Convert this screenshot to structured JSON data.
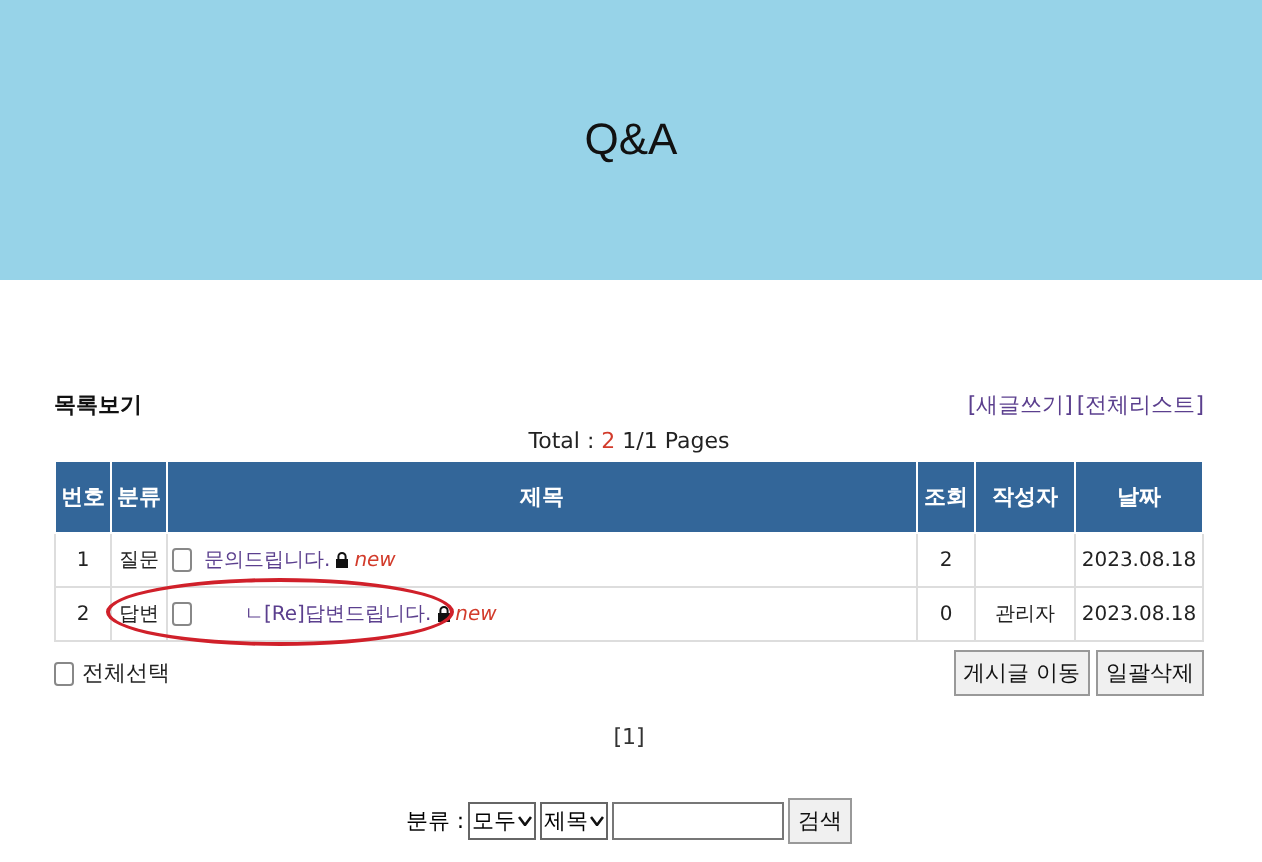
{
  "header": {
    "title": "Q&A"
  },
  "board": {
    "heading": "목록보기",
    "links": [
      "[새글쓰기]",
      "[전체리스트]"
    ],
    "summary": {
      "label": "Total : ",
      "count": "2",
      "pages": " 1/1 Pages"
    },
    "columns": [
      "번호",
      "분류",
      "제목",
      "조회",
      "작성자",
      "날짜"
    ],
    "rows": [
      {
        "number": "1",
        "category": "질문",
        "checked": false,
        "reply": false,
        "title": "문의드립니다.",
        "locked": true,
        "badge": "new",
        "views": "2",
        "author": "",
        "date": "2023.08.18",
        "highlighted": false
      },
      {
        "number": "2",
        "category": "답변",
        "checked": false,
        "reply": true,
        "title": "ㄴ[Re]답변드립니다.",
        "locked": true,
        "badge": "new",
        "views": "0",
        "author": "관리자",
        "date": "2023.08.18",
        "highlighted": true
      }
    ],
    "select_all": {
      "label": "전체선택",
      "checked": false
    },
    "buttons": [
      "게시글 이동",
      "일괄삭제"
    ],
    "pagination": [
      "[1]"
    ]
  },
  "search": {
    "label": "분류 :",
    "category": "모두",
    "field": "제목",
    "button": "검색"
  }
}
